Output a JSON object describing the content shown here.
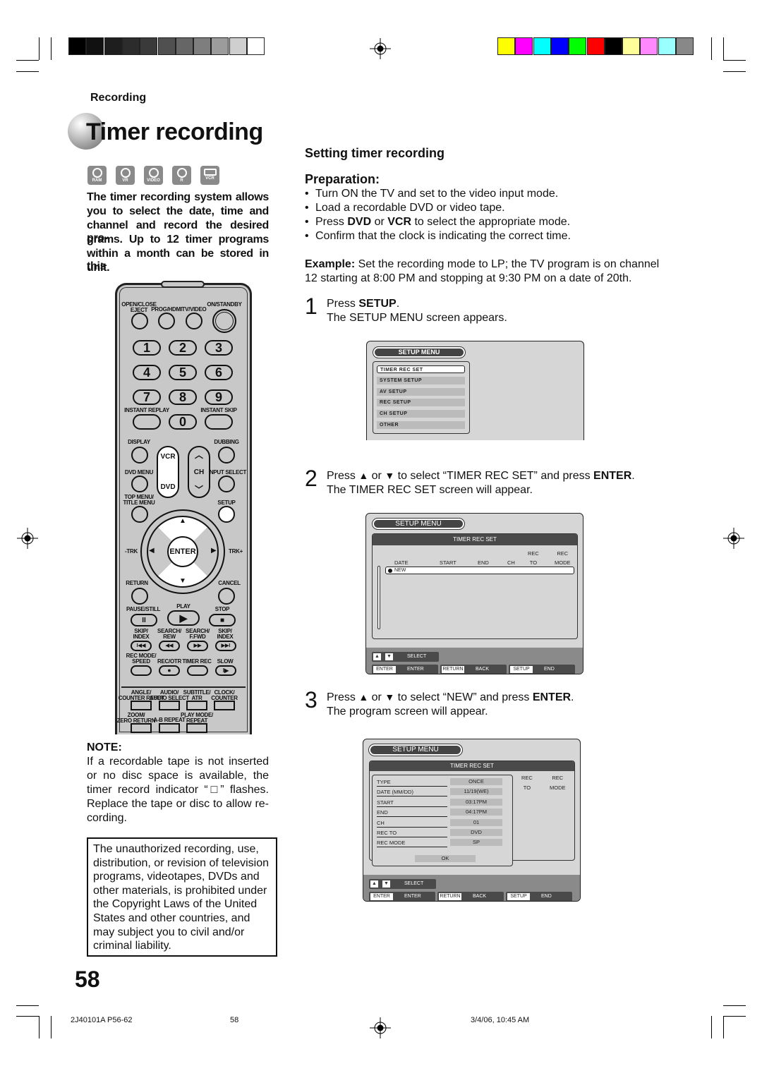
{
  "colors": {
    "gray_swatches": [
      "#000000",
      "#111111",
      "#1e1e1e",
      "#2c2c2c",
      "#3a3a3a",
      "#505050",
      "#666666",
      "#7e7e7e",
      "#9c9c9c",
      "#cfcfcf",
      "#ffffff"
    ],
    "color_swatches": [
      "#ffff00",
      "#ff00ff",
      "#00ffff",
      "#0000ff",
      "#00ff00",
      "#ff0000",
      "#000000",
      "#ffff99",
      "#ff88ff",
      "#99ffff",
      "#888888"
    ]
  },
  "header": {
    "section": "Recording",
    "title": "Timer recording",
    "disc_icons": [
      "RAM",
      "VR",
      "VIDEO",
      "R",
      "VCR"
    ]
  },
  "intro": [
    "The timer recording system allows",
    "you to select the date, time and",
    "channel and record the desired pro-",
    "grams. Up to 12 timer programs",
    "within a month can be stored in this",
    "unit."
  ],
  "remote": {
    "labels": {
      "open": "OPEN/CLOSE\nEJECT",
      "prog": "PROG/HDMI",
      "tv": "TV/VIDEO",
      "on": "ON/STANDBY",
      "ireplay": "INSTANT REPLAY",
      "iskip": "INSTANT SKIP",
      "display": "DISPLAY",
      "dubbing": "DUBBING",
      "dvdmenu": "DVD MENU",
      "input": "INPUT SELECT",
      "topmenu": "TOP MENU/\nTITLE MENU",
      "setup": "SETUP",
      "trkm": "-TRK",
      "trkp": "TRK+",
      "return": "RETURN",
      "cancel": "CANCEL",
      "pause": "PAUSE/STILL",
      "play": "PLAY",
      "stop": "STOP",
      "skipb": "SKIP/\nINDEX",
      "rew": "SEARCH/\nREW",
      "ffwd": "SEARCH/\nF.FWD",
      "skipf": "SKIP/\nINDEX",
      "recmode": "REC MODE/\nSPEED",
      "recotr": "REC/OTR",
      "timerrec": "TIMER REC",
      "slow": "SLOW",
      "angle": "ANGLE/\nCOUNTER RESET",
      "audio": "AUDIO/\nAUDIO SELECT",
      "subtitle": "SUBTITLE/\nATR",
      "clock": "CLOCK/\nCOUNTER",
      "zoom": "ZOOM/\nZERO RETURN",
      "ab": "A-B REPEAT",
      "playmode": "PLAY MODE/\nREPEAT"
    },
    "keys": {
      "k1": "1",
      "k2": "2",
      "k3": "3",
      "k4": "4",
      "k5": "5",
      "k6": "6",
      "k7": "7",
      "k8": "8",
      "k9": "9",
      "k0": "0",
      "vcr": "VCR",
      "dvd": "DVD",
      "ch": "CH",
      "enter": "ENTER",
      "pause": "II",
      "play": "▶",
      "stop": "■",
      "skipb": "I◀◀",
      "rew": "◀◀",
      "ffwd": "▶▶",
      "skipf": "▶▶I",
      "recotr": "●",
      "slow": "I▶",
      "up": "▲",
      "down": "▼",
      "left": "◀",
      "right": "▶",
      "chup": "︿",
      "chdn": "﹀"
    }
  },
  "note": {
    "heading": "NOTE:",
    "lines": [
      "If a recordable tape is not inserted",
      "or no disc space is available, the",
      "timer record indicator “□” flashes.",
      "Replace the tape or disc to allow re-",
      "cording."
    ]
  },
  "warning": [
    "The unauthorized recording, use,",
    "distribution, or revision of television",
    "programs, videotapes, DVDs and",
    "other materials, is prohibited under",
    "the Copyright Laws of the United",
    "States and other countries, and",
    "may subject you to civil and/or",
    "criminal liability."
  ],
  "page_number": "58",
  "footer": {
    "code": "2J40101A P56-62",
    "page": "58",
    "date": "3/4/06, 10:45 AM"
  },
  "main": {
    "heading": "Setting timer recording",
    "prep_heading": "Preparation:",
    "bullets": [
      [
        "Turn ON the TV and set to the video input mode."
      ],
      [
        "Load a recordable DVD or video tape."
      ],
      [
        "Press ",
        "DVD",
        " or ",
        "VCR",
        " to select the appropriate mode."
      ],
      [
        "Confirm that the clock is indicating the correct time."
      ]
    ],
    "example_label": "Example:",
    "example_line1": " Set the recording mode to LP; the TV program is on channel",
    "example_line2": "12 starting at 8:00 PM and stopping at 9:30 PM on a date of 20th.",
    "steps": [
      {
        "num": "1",
        "pre": "Press ",
        "key": "SETUP",
        "post": ".",
        "mid": "",
        "key2": "",
        "line2": "The SETUP MENU screen appears."
      },
      {
        "num": "2",
        "pre": "Press ",
        "mid": " or ",
        "post": " to select “TIMER REC SET” and press ",
        "key2": "ENTER",
        "line2": "The TIMER REC SET screen will appear."
      },
      {
        "num": "3",
        "pre": "Press ",
        "mid": " or ",
        "post": " to select “NEW” and press ",
        "key2": "ENTER",
        "line2": "The program screen will appear."
      }
    ]
  },
  "screen1": {
    "title": "SETUP MENU",
    "items": [
      "TIMER REC SET",
      "SYSTEM SETUP",
      "AV SETUP",
      "REC SETUP",
      "CH SETUP",
      "OTHER"
    ],
    "selected": 0
  },
  "screen2": {
    "title": "SETUP MENU",
    "subtitle": "TIMER REC SET",
    "cols": [
      "DATE",
      "START",
      "END",
      "CH",
      "REC\nTO",
      "REC\nMODE"
    ],
    "new": "NEW"
  },
  "screen3": {
    "title": "SETUP MENU",
    "subtitle": "TIMER REC SET",
    "rows": [
      [
        "TYPE",
        "ONCE"
      ],
      [
        "DATE (MM/DD)",
        "11/19(WE)"
      ],
      [
        "START",
        "03:17PM"
      ],
      [
        "END",
        "04:17PM"
      ],
      [
        "CH",
        "01"
      ],
      [
        "REC TO",
        "DVD"
      ],
      [
        "REC MODE",
        "SP"
      ]
    ],
    "ok": "OK",
    "side": [
      "REC\nTO",
      "REC\nMODE"
    ]
  },
  "screen_footer": {
    "select": "SELECT",
    "keys": [
      [
        "ENTER",
        "ENTER"
      ],
      [
        "RETURN",
        "BACK"
      ],
      [
        "SETUP",
        "END"
      ]
    ]
  }
}
